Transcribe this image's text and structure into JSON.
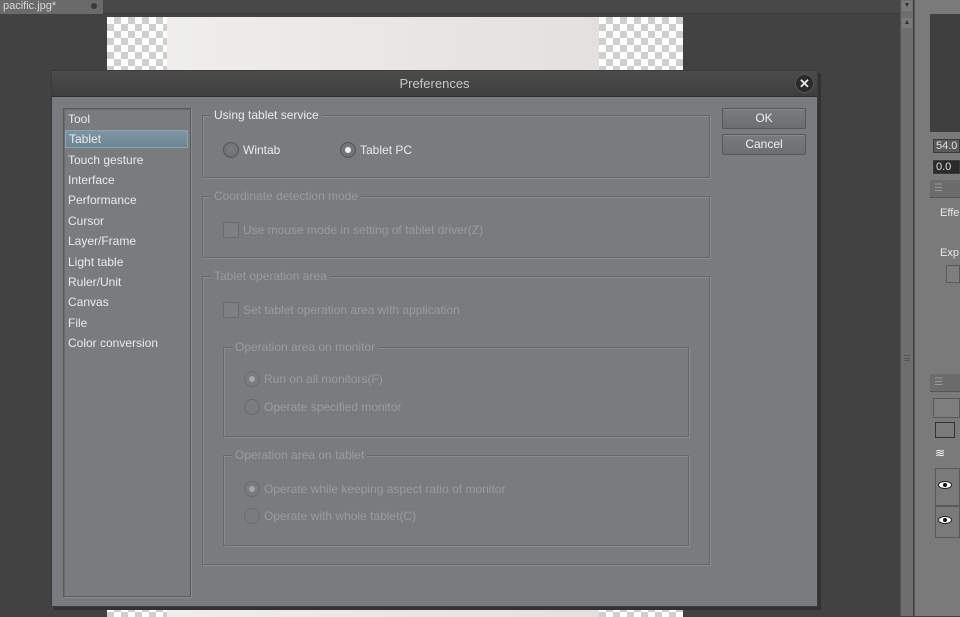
{
  "app": {
    "document_tab": "pacific.jpg*",
    "right_panel": {
      "value_a": "54.0",
      "value_b": "0.0",
      "label_effect": "Effe",
      "label_exp": "Exp"
    }
  },
  "dialog": {
    "title": "Preferences",
    "categories": [
      {
        "label": "Tool"
      },
      {
        "label": "Tablet",
        "selected": true
      },
      {
        "label": "Touch gesture"
      },
      {
        "label": "Interface"
      },
      {
        "label": "Performance"
      },
      {
        "label": "Cursor"
      },
      {
        "label": "Layer/Frame"
      },
      {
        "label": "Light table"
      },
      {
        "label": "Ruler/Unit"
      },
      {
        "label": "Canvas"
      },
      {
        "label": "File"
      },
      {
        "label": "Color conversion"
      }
    ],
    "buttons": {
      "ok": "OK",
      "cancel": "Cancel"
    },
    "tablet": {
      "service_group": {
        "label": "Using tablet service",
        "options": [
          {
            "label": "Wintab",
            "checked": false
          },
          {
            "label": "Tablet PC",
            "checked": true
          }
        ]
      },
      "coordinate_group": {
        "label": "Coordinate detection mode",
        "disabled": true,
        "checkbox": {
          "label": "Use mouse mode in setting of tablet driver(Z)",
          "checked": false
        }
      },
      "operation_area_group": {
        "label": "Tablet operation area",
        "disabled": true,
        "checkbox": {
          "label": "Set tablet operation area with application",
          "checked": false
        },
        "monitor_group": {
          "label": "Operation area on monitor",
          "options": [
            {
              "label": "Run on all monitors(F)",
              "checked": true
            },
            {
              "label": "Operate specified monitor",
              "checked": false
            }
          ]
        },
        "tablet_group": {
          "label": "Operation area on tablet",
          "options": [
            {
              "label": "Operate while keeping aspect ratio of monitor",
              "checked": true
            },
            {
              "label": "Operate with whole tablet(C)",
              "checked": false
            }
          ]
        }
      }
    }
  }
}
